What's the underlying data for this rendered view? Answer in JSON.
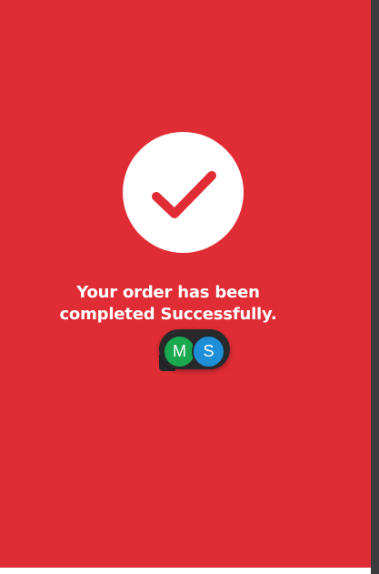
{
  "colors": {
    "background": "#e02d35",
    "circle": "#ffffff",
    "checkmark": "#e02d35",
    "text": "#ffffff",
    "avatar_pill": "#27292b",
    "avatar_m": "#1aa84f",
    "avatar_s": "#1e8fd6"
  },
  "success_icon": "checkmark-icon",
  "message": {
    "line1": "Your order has been",
    "line2": "completed Successfully."
  },
  "avatars": [
    {
      "initial": "M"
    },
    {
      "initial": "S"
    }
  ]
}
